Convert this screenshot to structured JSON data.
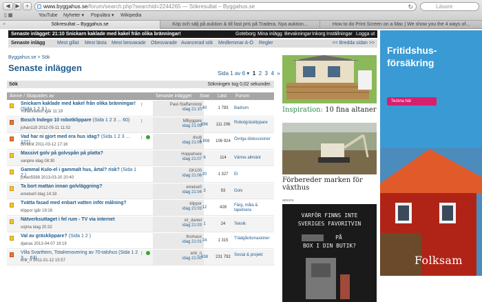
{
  "browser": {
    "url_base": "www.byggahus.se",
    "url_path": "/forum/search.php?searchid=2244265",
    "url_suffix": " — Sökresultat – Byggahus.se",
    "search_placeholder": "Läsare",
    "bookmarks": [
      "YouTube",
      "Nyheter ▾",
      "Populära ▾",
      "Wikipedia"
    ],
    "tabs": [
      {
        "label": "Sökresultat – Byggahus.se",
        "active": true
      },
      {
        "label": "Köp och sälj på auktion & till fast pris på Tradera. Nya auktion...",
        "active": false
      },
      {
        "label": "How to do Print Screen on a Mac | We show you the 4 ways of...",
        "active": false
      }
    ]
  },
  "site": {
    "notice": "Senaste inlägget: 21:10 Snickarn kaklade med kakel från olika bränningar!",
    "user_links": [
      "Goteborg",
      "Mina inlägg",
      "Bevakningar",
      "Inkorg",
      "Inställningar",
      "Logga ut"
    ],
    "subnav": [
      "Senaste inlägg",
      "Mest gillat",
      "Mest lästa",
      "Mest besvarade",
      "Obesvarade",
      "Avancerad sök",
      "Medlemmar A-Ö",
      "Regler"
    ],
    "bredda": "<< Bredda sidan >>"
  },
  "page": {
    "breadcrumb": "Byggahus.se > Sök",
    "title": "Senaste inläggen",
    "pager_label": "Sida 1 av 6 ▾",
    "pages": [
      "1",
      "2",
      "3",
      "4"
    ],
    "pager_next": "»",
    "search_label": "Sök",
    "search_time": "Sökningen tog 0,02 sekunder.",
    "headers": {
      "topic": "Ämne / Skapades av",
      "last": "Senaste inlägget",
      "replies": "Svar",
      "views": "Läst",
      "forum": "Forum"
    }
  },
  "rows": [
    {
      "title": "Snickarn kaklade med kakel från olika bränningar!",
      "pages": "(Sida 1 2 3 )",
      "starter": "Yohannaloof igår 11:19",
      "clip": true,
      "ok": false,
      "last_user": "Paul-Staffanstorp",
      "last_date": "idag 21:10",
      "replies": "40",
      "views": "1 783",
      "forum": "Badrum",
      "hot": false,
      "bold": true
    },
    {
      "title": "Bosch Indego 10 robotklippare",
      "pages": "(Sida 1 2 3 ... 60)",
      "starter": "johan119 2012-05-11 11:02",
      "clip": true,
      "ok": false,
      "last_user": "MByggare",
      "last_date": "idag 21:09",
      "replies": "896",
      "views": "111 206",
      "forum": "Robotgräsklippare",
      "hot": true,
      "bold": true
    },
    {
      "title": "Vad har ni gjort med era hus idag?",
      "pages": "(Sida 1 2 3 ... 121)",
      "starter": "Blindnit 2011-03-12 17:16",
      "clip": true,
      "ok": true,
      "last_user": "dsub",
      "last_date": "idag 21:09",
      "replies": "1 808",
      "views": "106 924",
      "forum": "Övriga diskussioner",
      "hot": true,
      "bold": true
    },
    {
      "title": "Massivt golv på golvspån på platta?",
      "pages": "",
      "starter": "vanpire idag 08:30",
      "clip": false,
      "ok": false,
      "last_user": "Hoppehare",
      "last_date": "idag 21:07",
      "replies": "6",
      "views": "114",
      "forum": "Värme allmänt",
      "hot": false,
      "bold": true
    },
    {
      "title": "Gammal Kulo-el i gammalt hus, årtal? risk?",
      "pages": "(Sida 1 2 )",
      "starter": "johan5588 2013-03-20 20:40",
      "clip": false,
      "ok": false,
      "last_user": "GK100",
      "last_date": "idag 21:06",
      "replies": "20",
      "views": "1 327",
      "forum": "El",
      "hot": false,
      "bold": true
    },
    {
      "title": "Ta bort mattan innan golvläggning?",
      "pages": "",
      "starter": "emelse0 idag 14:18",
      "clip": false,
      "ok": false,
      "last_user": "emelse0",
      "last_date": "idag 21:04",
      "replies": "3",
      "views": "93",
      "forum": "Golv",
      "hot": false,
      "bold": true
    },
    {
      "title": "Tvätta fasad med enbart vatten inför målning?",
      "pages": "",
      "starter": "klippor igår 19:26",
      "clip": false,
      "ok": false,
      "last_user": "klippor",
      "last_date": "idag 21:03",
      "replies": "12",
      "views": "428",
      "forum": "Färg, måla & tapetsera",
      "hot": false,
      "bold": true
    },
    {
      "title": "Nätverksuttaget i fel rum - TV via internet",
      "pages": "",
      "starter": "vojma idag 20:32",
      "clip": false,
      "ok": false,
      "last_user": "sir_daniel",
      "last_date": "idag 21:03",
      "replies": "1",
      "views": "24",
      "forum": "Teknik",
      "hot": false,
      "bold": true
    },
    {
      "title": "Val av gräsklippare?",
      "pages": "(Sida 1 2 )",
      "starter": "djanas 2013-04-07 19:19",
      "clip": false,
      "ok": false,
      "last_user": "thomasx",
      "last_date": "idag 21:01",
      "replies": "24",
      "views": "1 315",
      "forum": "Trädgårdsmaskiner",
      "hot": false,
      "bold": true
    },
    {
      "title": "Villa Svarthem, Totalrenovering av 70-talshus",
      "pages": "(Sida 1 2 3 ... 63)",
      "starter": "erik_n 2011-01-12 15:57",
      "clip": true,
      "ok": true,
      "last_user": "erik_n",
      "last_date": "idag 21:00",
      "replies": "938",
      "views": "231 792",
      "forum": "Social & projekt",
      "hot": true,
      "bold": false
    }
  ],
  "mid": {
    "caption1_prefix": "Inspiration:",
    "caption1_rest": " 10 fina altaner",
    "caption2": "Förbereder marken för växthus",
    "annons": "annons",
    "ad_lines": [
      "VARFÖR FINNS INTE",
      "SVERIGES FAVORITVIN",
      "PÅ",
      "BOX I DIN BUTIK?"
    ]
  },
  "right_ad": {
    "headline": "Fritidshus-försäkring",
    "button": "Teckna här",
    "brand": "Folksam"
  },
  "colors": {
    "site_blue": "#1f5b8c",
    "ad_blue": "#3a9ad4",
    "cta": "#d61f6e"
  }
}
